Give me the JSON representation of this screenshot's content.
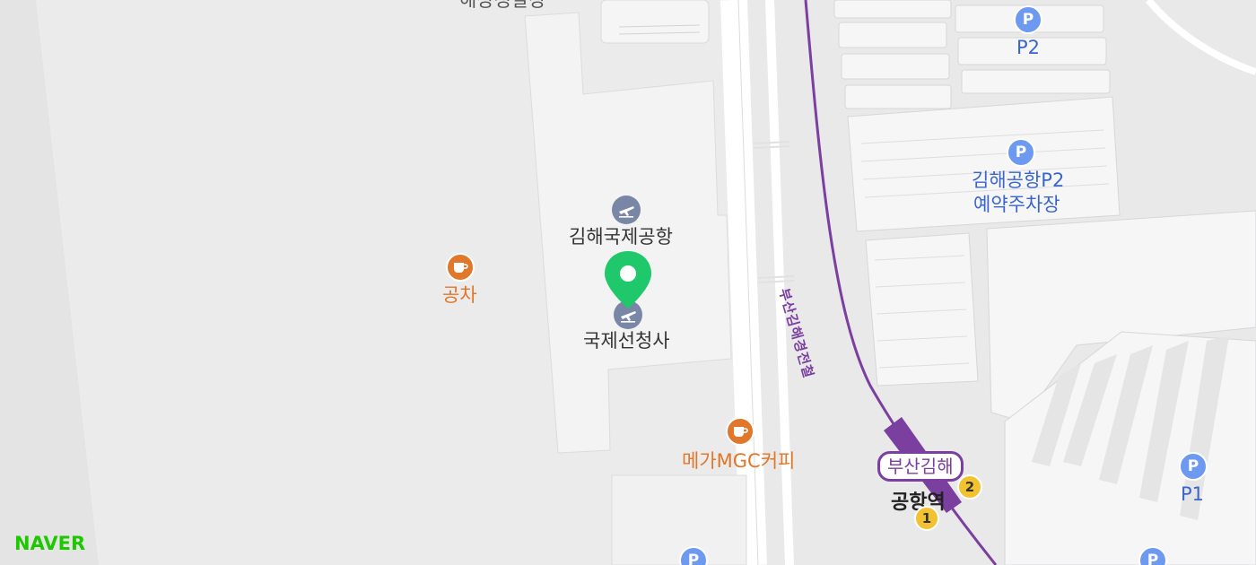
{
  "map": {
    "provider_logo": "NAVER",
    "cut_label": "해상정말장",
    "terminal": {
      "name": "김해국제공항",
      "icon": "airplane-icon"
    },
    "international_terminal": {
      "name": "국제선청사",
      "icon": "airplane-icon"
    },
    "selected_pin": {
      "icon": "location-pin-icon",
      "color": "#1fc86a"
    },
    "pois": [
      {
        "name": "공차",
        "icon": "coffee-cup-icon",
        "color": "#e0772a"
      },
      {
        "name": "메가MGC커피",
        "icon": "coffee-cup-icon",
        "color": "#e0772a"
      }
    ],
    "parking": [
      {
        "name": "P2",
        "icon": "parking-icon"
      },
      {
        "name": "김해공항P2",
        "name2": "예약주차장",
        "icon": "parking-icon"
      },
      {
        "name": "P1",
        "icon": "parking-icon"
      }
    ],
    "rail_line": {
      "name": "부산김해경전철",
      "color": "#7b3fa0"
    },
    "station": {
      "name_top": "부산김해",
      "name_bottom": "공항역",
      "exits": [
        "2",
        "1"
      ]
    }
  }
}
